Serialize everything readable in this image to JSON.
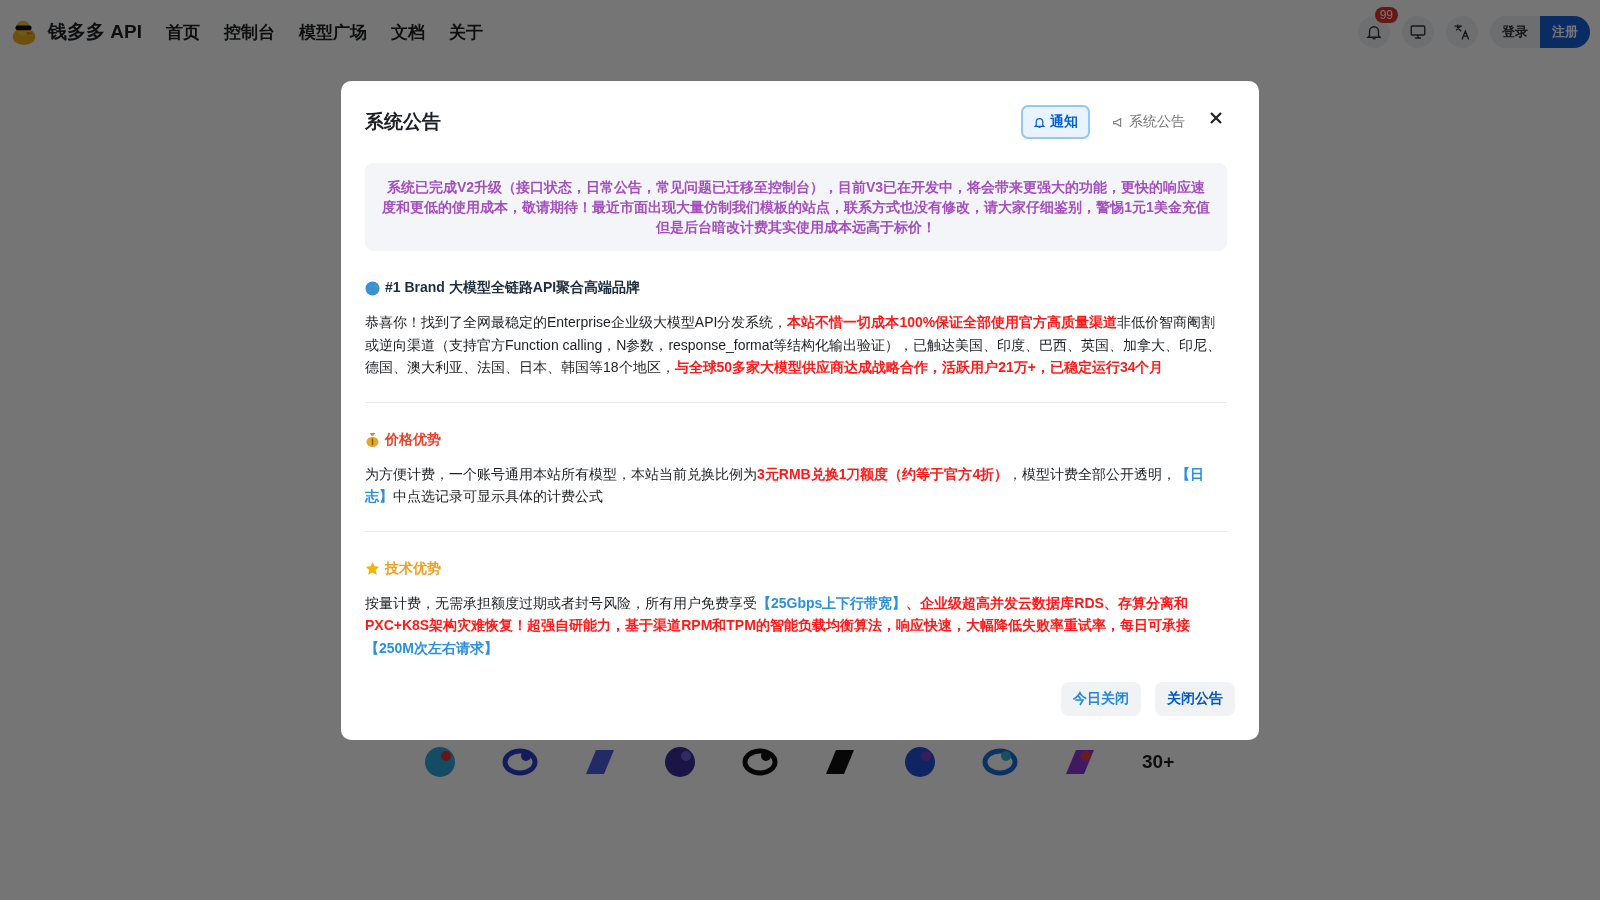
{
  "header": {
    "brand": "钱多多 API",
    "nav": [
      {
        "label": "首页"
      },
      {
        "label": "控制台"
      },
      {
        "label": "模型广场"
      },
      {
        "label": "文档"
      },
      {
        "label": "关于"
      }
    ],
    "notification_count": "99",
    "auth_buttons": [
      {
        "label": "登录",
        "kind": "secondary"
      },
      {
        "label": "注册",
        "kind": "primary"
      }
    ]
  },
  "providers": {
    "more": "30+"
  },
  "dialog": {
    "title": "系统公告",
    "tabs": [
      {
        "label": "通知",
        "kind": "bell",
        "selected": true
      },
      {
        "label": "系统公告",
        "kind": "megaphone",
        "selected": false
      }
    ],
    "notice": "系统已完成V2升级（接口状态，日常公告，常见问题已迁移至控制台），目前V3已在开发中，将会带来更强大的功能，更快的响应速度和更低的使用成本，敬请期待！最近市面出现大量仿制我们模板的站点，联系方式也没有修改，请大家仔细鉴别，警惕1元1美金充值但是后台暗改计费其实使用成本远高于标价！",
    "sections": [
      {
        "kind": "globe",
        "heading": "#1 Brand 大模型全链路API聚合高端品牌",
        "color": "#1f2d3d",
        "paragraph": [
          {
            "kind": "plain",
            "text": "恭喜你！找到了全网最稳定的Enterprise企业级大模型API分发系统，"
          },
          {
            "kind": "alert",
            "text": "本站不惜一切成本100%保证全部使用官方高质量渠道"
          },
          {
            "kind": "plain",
            "text": "非低价智商阉割或逆向渠道（支持官方Function calling，N参数，response_format等结构化输出验证），已触达美国、印度、巴西、英国、加拿大、印尼、德国、澳大利亚、法国、日本、韩国等18个地区，"
          },
          {
            "kind": "alert",
            "text": "与全球50多家大模型供应商达成战略合作，活跃用户21万+，已稳定运行34个月"
          }
        ]
      },
      {
        "kind": "money",
        "heading": "价格优势",
        "color": "#e5432f",
        "paragraph": [
          {
            "kind": "plain",
            "text": "为方便计费，一个账号通用本站所有模型，本站当前兑换比例为"
          },
          {
            "kind": "alert",
            "text": "3元RMB兑换1刀额度（约等于官方4折）"
          },
          {
            "kind": "plain",
            "text": "，模型计费全部公开透明，"
          },
          {
            "kind": "link",
            "text": "【日志】"
          },
          {
            "kind": "plain",
            "text": "中点选记录可显示具体的计费公式"
          }
        ]
      },
      {
        "kind": "star",
        "heading": "技术优势",
        "color": "#f0a020",
        "paragraph": [
          {
            "kind": "plain",
            "text": "按量计费，无需承担额度过期或者封号风险，所有用户免费享受"
          },
          {
            "kind": "link",
            "text": "【25Gbps上下行带宽】"
          },
          {
            "kind": "alert",
            "text": "、企业级超高并发云数据库RDS、存算分离和PXC+K8S架构灾难恢复！超强自研能力，基于渠道RPM和TPM的智能负载均衡算法，响应快速，大幅降低失败率重试率，每日可承接"
          },
          {
            "kind": "link",
            "text": "【250M次左右请求】"
          }
        ]
      }
    ],
    "buttons": [
      {
        "label": "今日关闭",
        "kind": "secondary"
      },
      {
        "label": "关闭公告",
        "kind": "primary"
      }
    ]
  }
}
